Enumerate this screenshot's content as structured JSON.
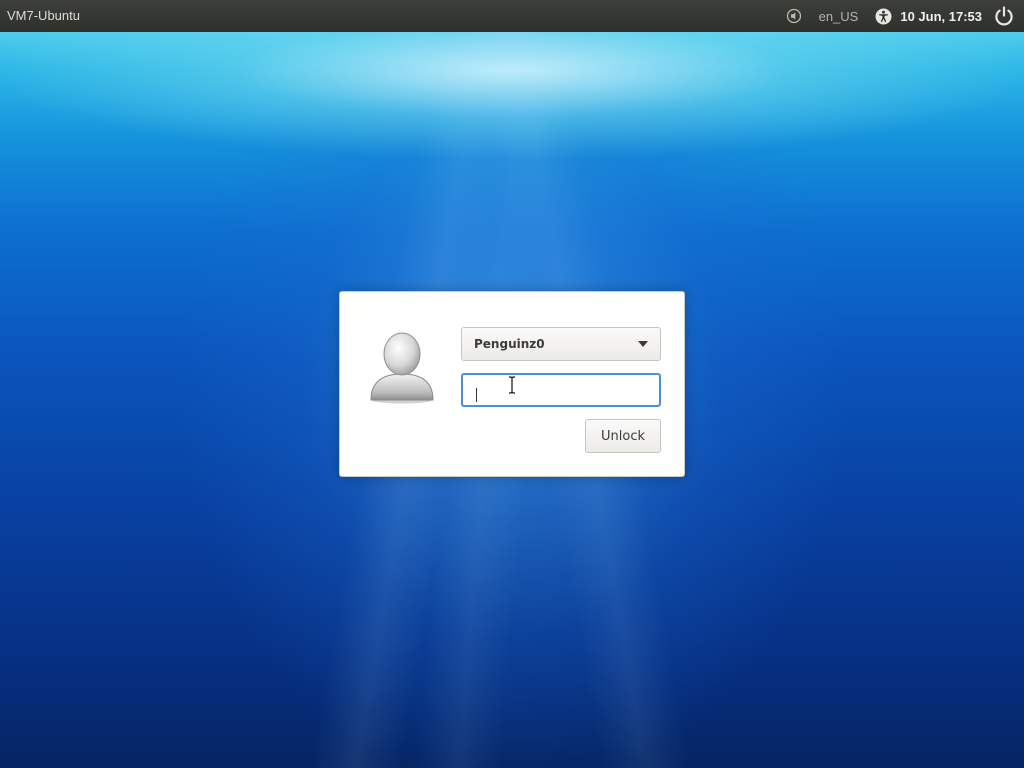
{
  "top_panel": {
    "hostname": "VM7-Ubuntu",
    "keyboard_layout": "en_US",
    "datetime": "10 Jun, 17:53",
    "icons": {
      "sound": "sound-icon",
      "accessibility": "accessibility-icon",
      "power": "power-icon"
    }
  },
  "unlock_dialog": {
    "avatar_icon": "user-avatar-icon",
    "user_selector": {
      "selected": "Penguinz0"
    },
    "password": {
      "value": "",
      "placeholder": ""
    },
    "unlock_label": "Unlock"
  },
  "colors": {
    "panel_bg": "#2e302c",
    "focus_border": "#4a90d9",
    "wallpaper_deep": "#052463",
    "wallpaper_surface": "#6fe0f2"
  }
}
